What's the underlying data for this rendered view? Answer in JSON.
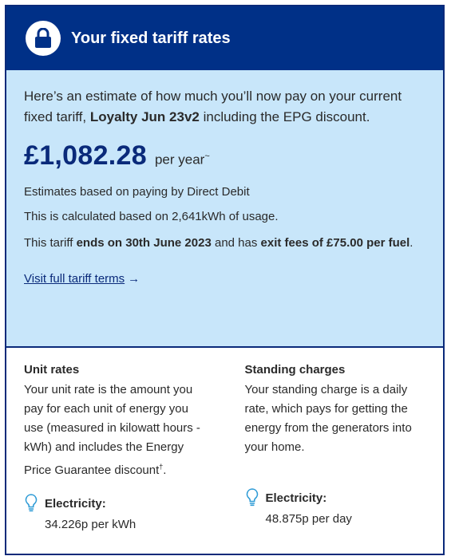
{
  "header": {
    "title": "Your fixed tariff rates",
    "icon": "lock-icon",
    "background": "#003087"
  },
  "estimate": {
    "background": "#c8e6fa",
    "intro_before": "Here’s an estimate of how much you’ll now pay on your current fixed tariff, ",
    "tariff_name": "Loyalty Jun 23v2",
    "intro_after": " including the EPG discount.",
    "price": "£1,082.28",
    "per_year": "per year",
    "per_year_mark": "~",
    "direct_debit_note": "Estimates based on paying by Direct Debit",
    "usage_note": "This is calculated based on 2,641kWh of usage.",
    "ends_before": "This tariff ",
    "ends_bold": "ends on 30th June 2023",
    "ends_middle": " and has ",
    "exit_bold": "exit fees of £75.00 per fuel",
    "ends_after": ".",
    "link_label": "Visit full tariff terms",
    "link_arrow": "→"
  },
  "unit_rates": {
    "title": "Unit rates",
    "description": "Your unit rate is the amount you pay for each unit of energy you use (measured in kilowatt hours - kWh) and includes the Energy Price Guarantee discount",
    "description_mark": "†",
    "description_end": ".",
    "electricity_label": "Electricity:",
    "electricity_rate": "34.226p per kWh",
    "icon": "lightbulb-icon"
  },
  "standing_charges": {
    "title": "Standing charges",
    "description": "Your standing charge is a daily rate, which pays for getting the energy from the generators into your home.",
    "electricity_label": "Electricity:",
    "electricity_rate": "48.875p per day",
    "icon": "lightbulb-icon"
  }
}
